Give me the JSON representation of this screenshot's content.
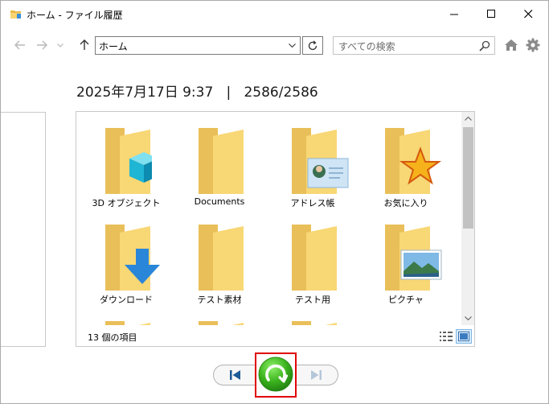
{
  "window": {
    "title": "ホーム - ファイル履歴"
  },
  "nav": {
    "address": "ホーム",
    "search_placeholder": "すべての検索"
  },
  "snapshot": {
    "datetime": "2025年7月17日 9:37",
    "separator": "|",
    "position": "2586/2586"
  },
  "folders": [
    {
      "label": "3D オブジェクト",
      "overlay": "3d-cube-icon"
    },
    {
      "label": "Documents",
      "overlay": "none"
    },
    {
      "label": "アドレス帳",
      "overlay": "contact-card-icon"
    },
    {
      "label": "お気に入り",
      "overlay": "star-icon"
    },
    {
      "label": "ダウンロード",
      "overlay": "download-arrow-icon"
    },
    {
      "label": "テスト素材",
      "overlay": "none"
    },
    {
      "label": "テスト用",
      "overlay": "none"
    },
    {
      "label": "ピクチャ",
      "overlay": "landscape-photo-icon"
    }
  ],
  "status": {
    "item_count": "13 個の項目"
  },
  "colors": {
    "folder_back": "#e9bf59",
    "folder_front": "#f8d775",
    "restore_green": "#3cb41e",
    "highlight_red": "#e00000",
    "nav_blue": "#1e5a96"
  }
}
